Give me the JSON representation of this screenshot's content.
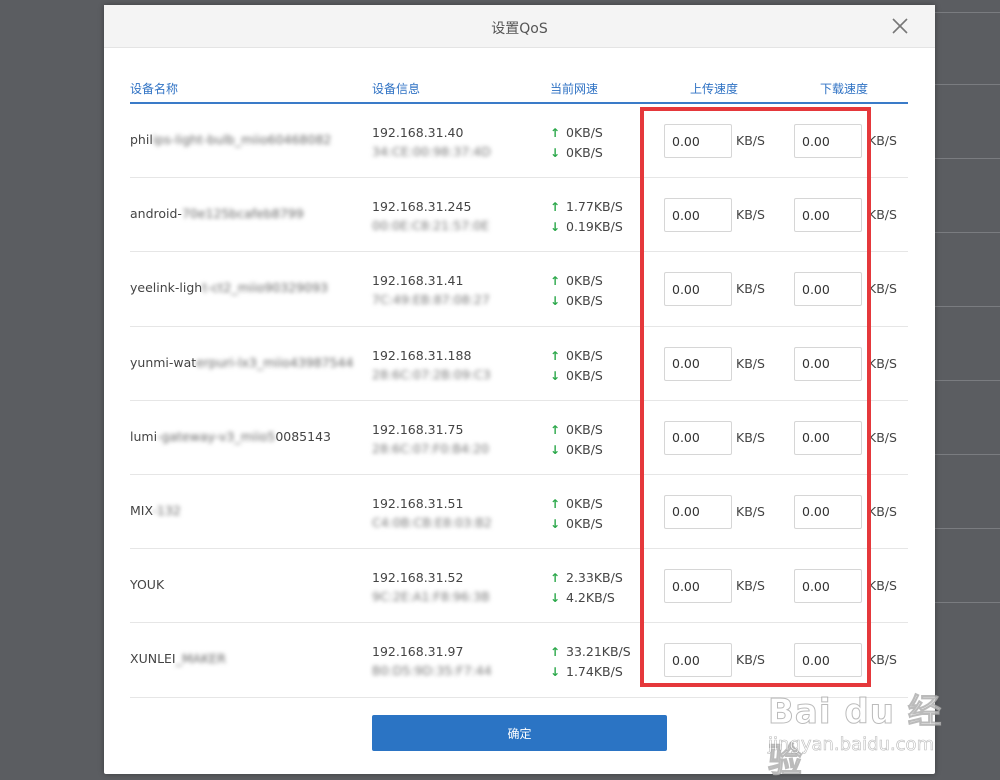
{
  "dialog": {
    "title": "设置QoS",
    "confirm_label": "确定"
  },
  "table": {
    "headers": {
      "name": "设备名称",
      "info": "设备信息",
      "speed": "当前网速",
      "upload": "上传速度",
      "download": "下载速度"
    },
    "unit": "KB/S",
    "rows": [
      {
        "name_visible": "phil",
        "name_blurred": "ips-light-bulb_miio60468082",
        "ip": "192.168.31.40",
        "mac": "34:CE:00:98:37:4D",
        "up_speed": "0KB/S",
        "down_speed": "0KB/S",
        "upload_value": "0.00",
        "download_value": "0.00"
      },
      {
        "name_visible": "android-",
        "name_blurred": "70e125bcafeb8799",
        "ip": "192.168.31.245",
        "mac": "00:0E:C8:21:57:0E",
        "up_speed": "1.77KB/S",
        "down_speed": "0.19KB/S",
        "upload_value": "0.00",
        "download_value": "0.00"
      },
      {
        "name_visible": "yeelink-ligh",
        "name_blurred": "t-ct2_miio90329093",
        "ip": "192.168.31.41",
        "mac": "7C:49:EB:87:08:27",
        "up_speed": "0KB/S",
        "down_speed": "0KB/S",
        "upload_value": "0.00",
        "download_value": "0.00"
      },
      {
        "name_visible": "yunmi-wat",
        "name_blurred": "erpuri-lx3_miio43987544",
        "ip": "192.168.31.188",
        "mac": "28:6C:07:2B:09:C3",
        "up_speed": "0KB/S",
        "down_speed": "0KB/S",
        "upload_value": "0.00",
        "download_value": "0.00"
      },
      {
        "name_visible": "lumi",
        "name_blurred": "-gateway-v3_miio5",
        "name_tail": "0085143",
        "ip": "192.168.31.75",
        "mac": "28:6C:07:F0:B4:20",
        "up_speed": "0KB/S",
        "down_speed": "0KB/S",
        "upload_value": "0.00",
        "download_value": "0.00"
      },
      {
        "name_visible": "MIX",
        "name_blurred": "-132",
        "ip": "192.168.31.51",
        "mac": "C4:0B:CB:E8:03:B2",
        "up_speed": "0KB/S",
        "down_speed": "0KB/S",
        "upload_value": "0.00",
        "download_value": "0.00"
      },
      {
        "name_visible": "YOUK",
        "name_blurred": "",
        "ip": "192.168.31.52",
        "mac": "9C:2E:A1:F8:96:3B",
        "up_speed": "2.33KB/S",
        "down_speed": "4.2KB/S",
        "upload_value": "0.00",
        "download_value": "0.00"
      },
      {
        "name_visible": "XUNLEI",
        "name_blurred": "_MAKER",
        "ip": "192.168.31.97",
        "mac": "B0:D5:9D:35:F7:44",
        "up_speed": "33.21KB/S",
        "down_speed": "1.74KB/S",
        "upload_value": "0.00",
        "download_value": "0.00"
      }
    ]
  },
  "icons": {
    "close": "close-icon",
    "up_arrow": "arrow-up-icon",
    "down_arrow": "arrow-down-icon"
  },
  "colors": {
    "accent": "#2f72c4",
    "button": "#2b74c4",
    "arrow": "#2ba84a",
    "highlight_box": "#e5383b"
  },
  "watermark": {
    "logo_text": "Bai du 经验",
    "url": "jingyan.baidu.com"
  }
}
